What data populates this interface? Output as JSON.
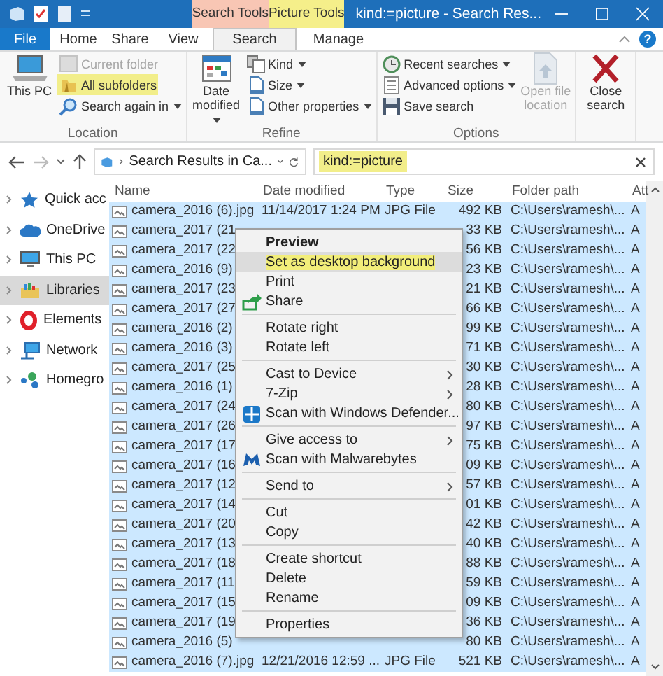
{
  "title_bar": {
    "title": "kind:=picture - Search Res...",
    "contextual_tabs": [
      {
        "label": "Search Tools",
        "color": "#f8c6b4"
      },
      {
        "label": "Picture Tools",
        "color": "#f5ef8a"
      }
    ]
  },
  "ribbon_tabs": [
    {
      "label": "File",
      "kind": "file",
      "selected": false
    },
    {
      "label": "Home",
      "kind": "tab",
      "selected": false
    },
    {
      "label": "Share",
      "kind": "tab",
      "selected": false
    },
    {
      "label": "View",
      "kind": "tab",
      "selected": false
    },
    {
      "label": "Search",
      "kind": "tab",
      "selected": true
    },
    {
      "label": "Manage",
      "kind": "tab",
      "selected": false
    }
  ],
  "help_label": "?",
  "ribbon_groups": [
    {
      "label": "Location",
      "items": [
        {
          "label": "This PC",
          "kind": "large",
          "dropdown": false,
          "disabled": false,
          "highlighted": false
        },
        {
          "label": "Current folder",
          "kind": "small",
          "dropdown": false,
          "disabled": true,
          "highlighted": false
        },
        {
          "label": "All subfolders",
          "kind": "small",
          "dropdown": false,
          "disabled": false,
          "highlighted": true
        },
        {
          "label": "Search again in",
          "kind": "small",
          "dropdown": true,
          "disabled": false,
          "highlighted": false
        }
      ]
    },
    {
      "label": "Refine",
      "items": [
        {
          "label": "Date modified",
          "kind": "large",
          "dropdown": true,
          "disabled": false,
          "highlighted": false
        },
        {
          "label": "Kind",
          "kind": "small",
          "dropdown": true,
          "disabled": false,
          "highlighted": false
        },
        {
          "label": "Size",
          "kind": "small",
          "dropdown": true,
          "disabled": false,
          "highlighted": false
        },
        {
          "label": "Other properties",
          "kind": "small",
          "dropdown": true,
          "disabled": false,
          "highlighted": false
        }
      ]
    },
    {
      "label": "Options",
      "items": [
        {
          "label": "Recent searches",
          "kind": "small",
          "dropdown": true,
          "disabled": false,
          "highlighted": false
        },
        {
          "label": "Advanced options",
          "kind": "small",
          "dropdown": true,
          "disabled": false,
          "highlighted": false
        },
        {
          "label": "Save search",
          "kind": "small",
          "dropdown": false,
          "disabled": false,
          "highlighted": false
        },
        {
          "label": "Open file location",
          "kind": "large",
          "dropdown": false,
          "disabled": true,
          "highlighted": false
        }
      ]
    },
    {
      "items": [
        {
          "label": "Close search",
          "kind": "large",
          "dropdown": false,
          "disabled": false,
          "highlighted": false
        }
      ]
    }
  ],
  "address": {
    "path": "Search Results in Ca..."
  },
  "search": {
    "value": "kind:=picture",
    "highlighted": true
  },
  "sidebar": {
    "items": [
      {
        "label": "Quick acc",
        "selected": false
      },
      {
        "label": "OneDrive",
        "selected": false
      },
      {
        "label": "This PC",
        "selected": false
      },
      {
        "label": "Libraries",
        "selected": true
      },
      {
        "label": "Elements",
        "selected": false
      },
      {
        "label": "Network",
        "selected": false
      },
      {
        "label": "Homegro",
        "selected": false
      }
    ]
  },
  "table": {
    "columns": [
      "Name",
      "Date modified",
      "Type",
      "Size",
      "Folder path",
      "Att"
    ],
    "rows": [
      {
        "name": "camera_2016 (6).jpg",
        "date": "11/14/2017 1:24 PM",
        "type": "JPG File",
        "size": "492 KB",
        "path": "C:\\Users\\ramesh\\...",
        "attr": "A",
        "selected": true
      },
      {
        "name": "camera_2017 (21",
        "size": "33 KB",
        "path": "C:\\Users\\ramesh\\...",
        "attr": "A",
        "selected": true
      },
      {
        "name": "camera_2017 (22",
        "size": "56 KB",
        "path": "C:\\Users\\ramesh\\...",
        "attr": "A",
        "selected": true
      },
      {
        "name": "camera_2016 (9)",
        "size": "23 KB",
        "path": "C:\\Users\\ramesh\\...",
        "attr": "A",
        "selected": true
      },
      {
        "name": "camera_2017 (23",
        "size": "21 KB",
        "path": "C:\\Users\\ramesh\\...",
        "attr": "A",
        "selected": true
      },
      {
        "name": "camera_2017 (27",
        "size": "66 KB",
        "path": "C:\\Users\\ramesh\\...",
        "attr": "A",
        "selected": true
      },
      {
        "name": "camera_2016 (2)",
        "size": "99 KB",
        "path": "C:\\Users\\ramesh\\...",
        "attr": "A",
        "selected": true
      },
      {
        "name": "camera_2016 (3)",
        "size": "71 KB",
        "path": "C:\\Users\\ramesh\\...",
        "attr": "A",
        "selected": true
      },
      {
        "name": "camera_2017 (25",
        "size": "30 KB",
        "path": "C:\\Users\\ramesh\\...",
        "attr": "A",
        "selected": true
      },
      {
        "name": "camera_2016 (1)",
        "size": "28 KB",
        "path": "C:\\Users\\ramesh\\...",
        "attr": "A",
        "selected": true
      },
      {
        "name": "camera_2017 (24",
        "size": "80 KB",
        "path": "C:\\Users\\ramesh\\...",
        "attr": "A",
        "selected": true
      },
      {
        "name": "camera_2017 (26",
        "size": "97 KB",
        "path": "C:\\Users\\ramesh\\...",
        "attr": "A",
        "selected": true
      },
      {
        "name": "camera_2017 (17",
        "size": "75 KB",
        "path": "C:\\Users\\ramesh\\...",
        "attr": "A",
        "selected": true
      },
      {
        "name": "camera_2017 (16",
        "size": "09 KB",
        "path": "C:\\Users\\ramesh\\...",
        "attr": "A",
        "selected": true
      },
      {
        "name": "camera_2017 (12",
        "size": "57 KB",
        "path": "C:\\Users\\ramesh\\...",
        "attr": "A",
        "selected": true
      },
      {
        "name": "camera_2017 (14",
        "size": "01 KB",
        "path": "C:\\Users\\ramesh\\...",
        "attr": "A",
        "selected": true
      },
      {
        "name": "camera_2017 (20",
        "size": "42 KB",
        "path": "C:\\Users\\ramesh\\...",
        "attr": "A",
        "selected": true
      },
      {
        "name": "camera_2017 (13",
        "size": "40 KB",
        "path": "C:\\Users\\ramesh\\...",
        "attr": "A",
        "selected": true
      },
      {
        "name": "camera_2017 (18",
        "size": "88 KB",
        "path": "C:\\Users\\ramesh\\...",
        "attr": "A",
        "selected": true
      },
      {
        "name": "camera_2017 (11",
        "size": "59 KB",
        "path": "C:\\Users\\ramesh\\...",
        "attr": "A",
        "selected": true
      },
      {
        "name": "camera_2017 (15",
        "size": "09 KB",
        "path": "C:\\Users\\ramesh\\...",
        "attr": "A",
        "selected": true
      },
      {
        "name": "camera_2017 (19",
        "size": "36 KB",
        "path": "C:\\Users\\ramesh\\...",
        "attr": "A",
        "selected": true
      },
      {
        "name": "camera_2016 (5)",
        "size": "80 KB",
        "path": "C:\\Users\\ramesh\\...",
        "attr": "A",
        "selected": true
      },
      {
        "name": "camera_2016 (7).jpg",
        "date": "12/21/2016 12:59 ...",
        "type": "JPG File",
        "size": "521 KB",
        "path": "C:\\Users\\ramesh\\...",
        "attr": "A",
        "selected": true
      }
    ]
  },
  "context_menu": {
    "items": [
      {
        "kind": "item",
        "label": "Preview",
        "bold": true,
        "submenu": false,
        "hovered": false,
        "highlighted": false
      },
      {
        "kind": "item",
        "label": "Set as desktop background",
        "bold": false,
        "submenu": false,
        "hovered": true,
        "highlighted": true
      },
      {
        "kind": "item",
        "label": "Print",
        "bold": false,
        "submenu": false,
        "hovered": false,
        "highlighted": false
      },
      {
        "kind": "item",
        "label": "Share",
        "bold": false,
        "submenu": false,
        "hovered": false,
        "highlighted": false
      },
      {
        "kind": "separator"
      },
      {
        "kind": "item",
        "label": "Rotate right",
        "bold": false,
        "submenu": false,
        "hovered": false,
        "highlighted": false
      },
      {
        "kind": "item",
        "label": "Rotate left",
        "bold": false,
        "submenu": false,
        "hovered": false,
        "highlighted": false
      },
      {
        "kind": "separator"
      },
      {
        "kind": "item",
        "label": "Cast to Device",
        "bold": false,
        "submenu": true,
        "hovered": false,
        "highlighted": false
      },
      {
        "kind": "item",
        "label": "7-Zip",
        "bold": false,
        "submenu": true,
        "hovered": false,
        "highlighted": false
      },
      {
        "kind": "item",
        "label": "Scan with Windows Defender...",
        "bold": false,
        "submenu": false,
        "hovered": false,
        "highlighted": false
      },
      {
        "kind": "separator"
      },
      {
        "kind": "item",
        "label": "Give access to",
        "bold": false,
        "submenu": true,
        "hovered": false,
        "highlighted": false
      },
      {
        "kind": "item",
        "label": "Scan with Malwarebytes",
        "bold": false,
        "submenu": false,
        "hovered": false,
        "highlighted": false
      },
      {
        "kind": "separator"
      },
      {
        "kind": "item",
        "label": "Send to",
        "bold": false,
        "submenu": true,
        "hovered": false,
        "highlighted": false
      },
      {
        "kind": "separator"
      },
      {
        "kind": "item",
        "label": "Cut",
        "bold": false,
        "submenu": false,
        "hovered": false,
        "highlighted": false
      },
      {
        "kind": "item",
        "label": "Copy",
        "bold": false,
        "submenu": false,
        "hovered": false,
        "highlighted": false
      },
      {
        "kind": "separator"
      },
      {
        "kind": "item",
        "label": "Create shortcut",
        "bold": false,
        "submenu": false,
        "hovered": false,
        "highlighted": false
      },
      {
        "kind": "item",
        "label": "Delete",
        "bold": false,
        "submenu": false,
        "hovered": false,
        "highlighted": false
      },
      {
        "kind": "item",
        "label": "Rename",
        "bold": false,
        "submenu": false,
        "hovered": false,
        "highlighted": false
      },
      {
        "kind": "separator"
      },
      {
        "kind": "item",
        "label": "Properties",
        "bold": false,
        "submenu": false,
        "hovered": false,
        "highlighted": false
      }
    ]
  }
}
